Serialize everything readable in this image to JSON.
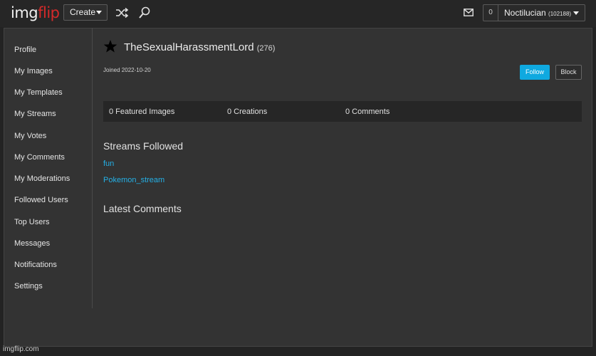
{
  "header": {
    "logo_img": "img",
    "logo_flip": "flip",
    "create_label": "Create",
    "notif_count": "0",
    "user_name": "Noctilucian",
    "user_points": "(102188)",
    "icons": [
      "shuffle-icon",
      "search-icon",
      "mail-icon",
      "chevron-down-icon"
    ]
  },
  "sidebar": {
    "items": [
      {
        "label": "Profile"
      },
      {
        "label": "My Images"
      },
      {
        "label": "My Templates"
      },
      {
        "label": "My Streams"
      },
      {
        "label": "My Votes"
      },
      {
        "label": "My Comments"
      },
      {
        "label": "My Moderations"
      },
      {
        "label": "Followed Users"
      },
      {
        "label": "Top Users"
      },
      {
        "label": "Messages"
      },
      {
        "label": "Notifications"
      },
      {
        "label": "Settings"
      }
    ]
  },
  "profile": {
    "username": "TheSexualHarassmentLord",
    "points": "(276)",
    "joined": "Joined 2022-10-20",
    "follow_label": "Follow",
    "block_label": "Block",
    "stats": {
      "featured": "0 Featured Images",
      "creations": "0 Creations",
      "comments": "0 Comments"
    }
  },
  "streams": {
    "title": "Streams Followed",
    "items": [
      {
        "label": "fun"
      },
      {
        "label": "Pokemon_stream"
      }
    ]
  },
  "latest_comments": {
    "title": "Latest Comments"
  },
  "footer": {
    "watermark": "imgflip.com"
  },
  "colors": {
    "accent": "#0fa9e0",
    "link": "#24b0e6",
    "logo_red": "#d42a2a",
    "panel": "#333333",
    "topbar": "#262626"
  }
}
